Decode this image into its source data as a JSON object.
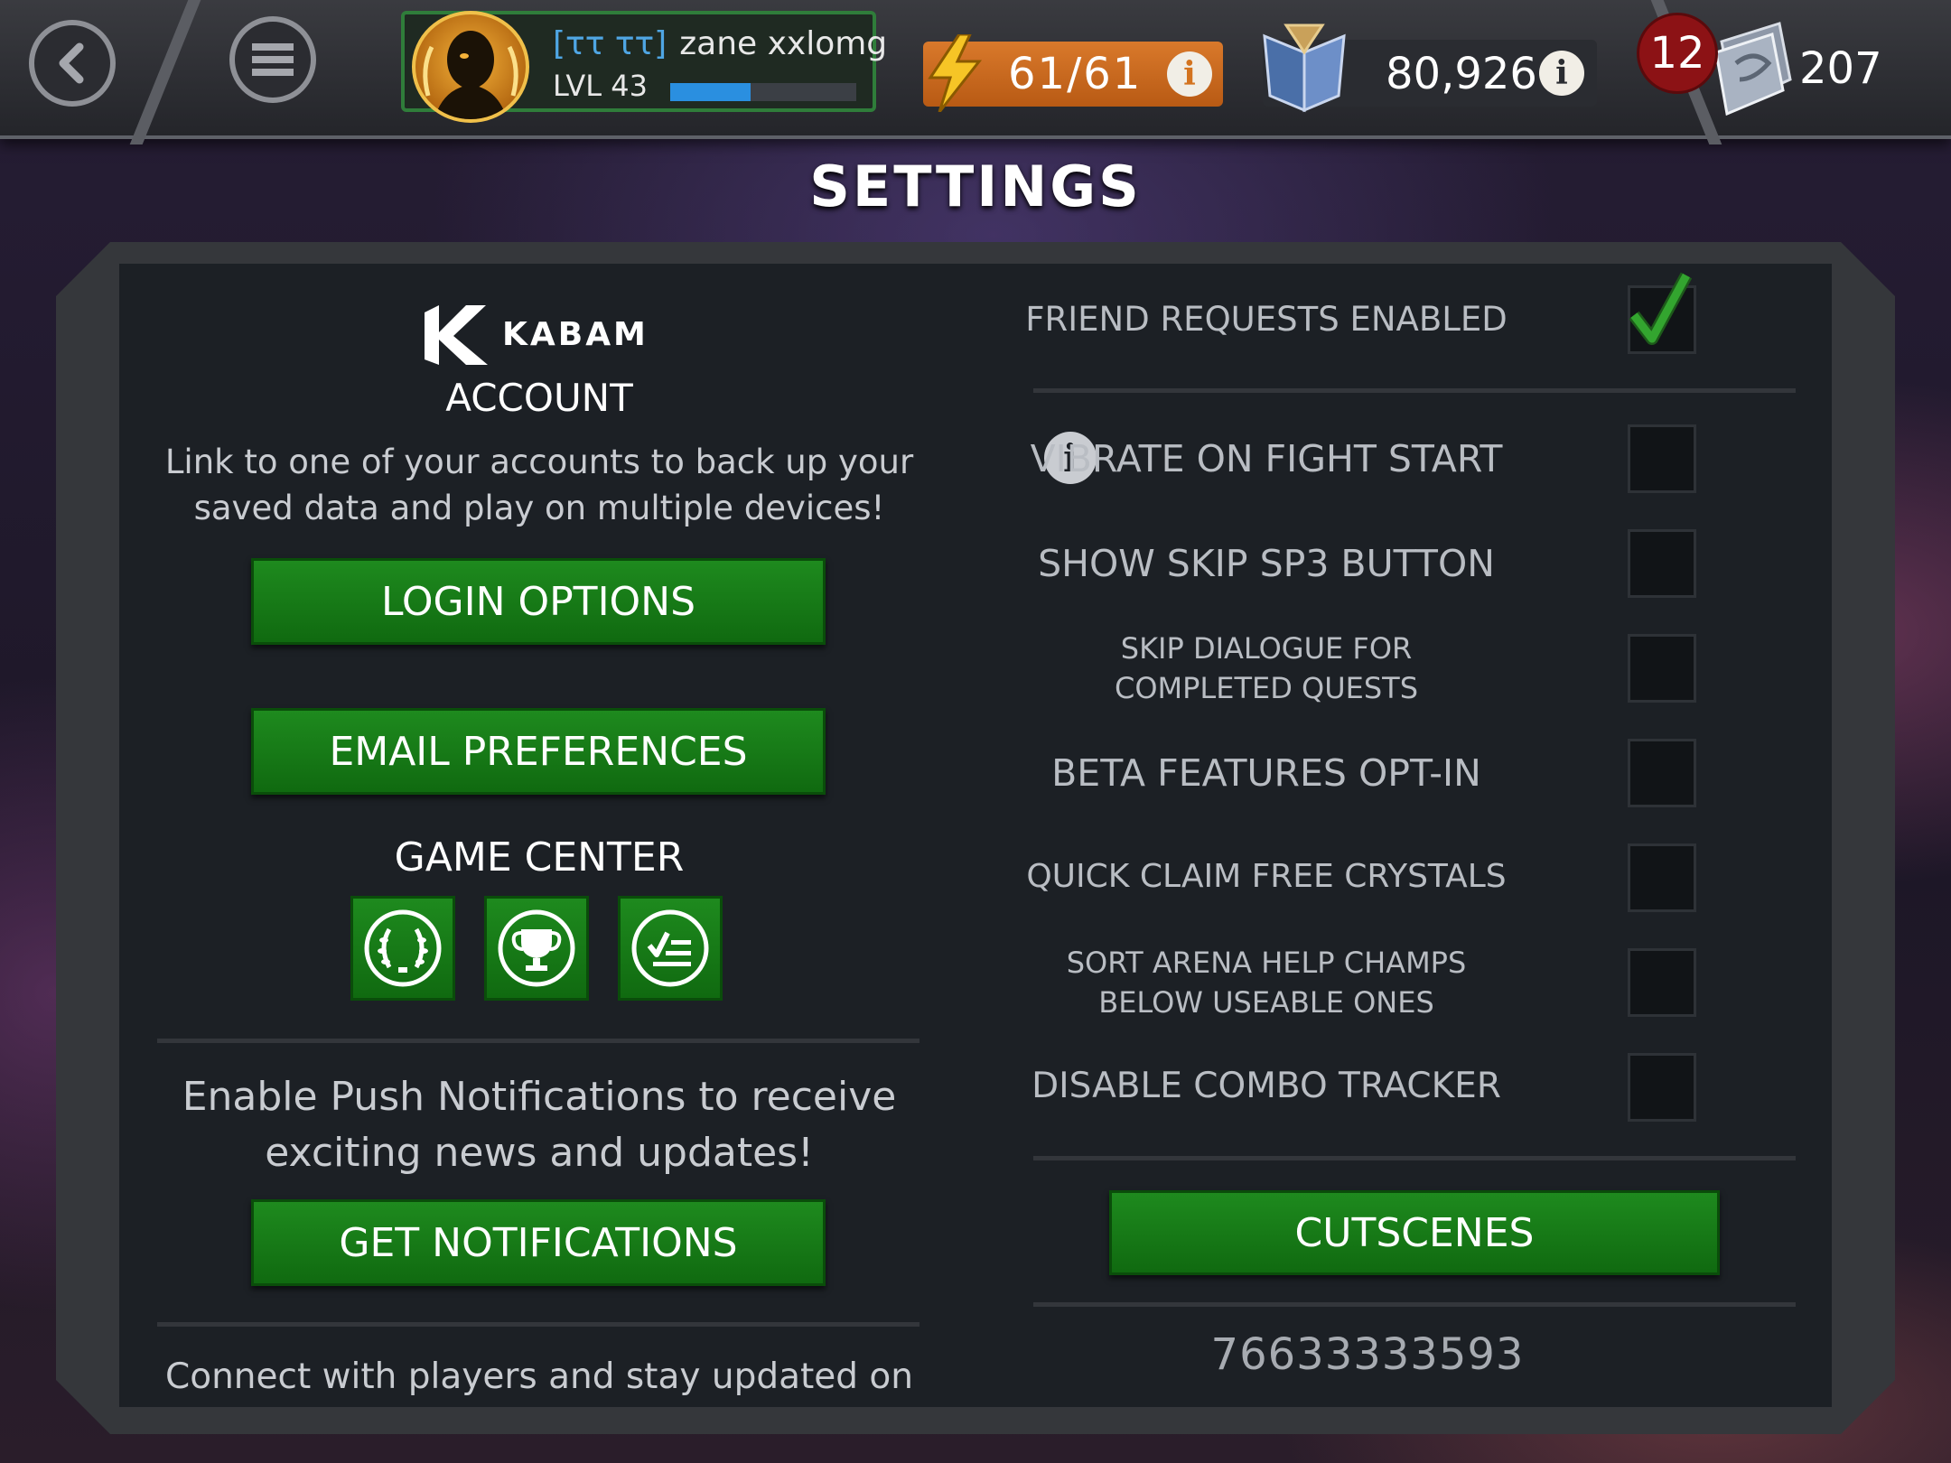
{
  "header": {
    "player_tag": "[ττ ττ]",
    "player_name": "zane xxlomg",
    "level_label": "LVL 43",
    "xp_fraction": 0.43,
    "energy": "61/61",
    "gold": "80,926",
    "notification_count": "12",
    "crystals": "207"
  },
  "page_title": "SETTINGS",
  "account": {
    "brand": "KABAM",
    "heading": "ACCOUNT",
    "description_line1": "Link to one of your accounts to back up your",
    "description_line2": "saved data and play on multiple devices!",
    "login_button": "LOGIN OPTIONS",
    "email_button": "EMAIL PREFERENCES",
    "game_center_heading": "GAME CENTER",
    "push_line1": "Enable Push Notifications to receive",
    "push_line2": "exciting news and updates!",
    "notifications_button": "GET NOTIFICATIONS",
    "connect_text": "Connect with players and stay updated on"
  },
  "settings": {
    "friend_requests": "FRIEND REQUESTS ENABLED",
    "vibrate": "VIBRATE ON FIGHT START",
    "skip_sp3": "SHOW SKIP SP3 BUTTON",
    "skip_dialogue_line1": "SKIP DIALOGUE FOR",
    "skip_dialogue_line2": "COMPLETED QUESTS",
    "beta": "BETA FEATURES OPT-IN",
    "quick_claim": "QUICK CLAIM FREE CRYSTALS",
    "sort_arena_line1": "SORT ARENA HELP CHAMPS",
    "sort_arena_line2": "BELOW USEABLE ONES",
    "combo_tracker": "DISABLE COMBO TRACKER",
    "cutscenes_button": "CUTSCENES",
    "player_id": "76633333593"
  },
  "colors": {
    "button_green": "#1e8a1e",
    "energy_orange": "#d9792b",
    "check_green": "#33a52f",
    "tag_blue": "#4fa6e4"
  }
}
